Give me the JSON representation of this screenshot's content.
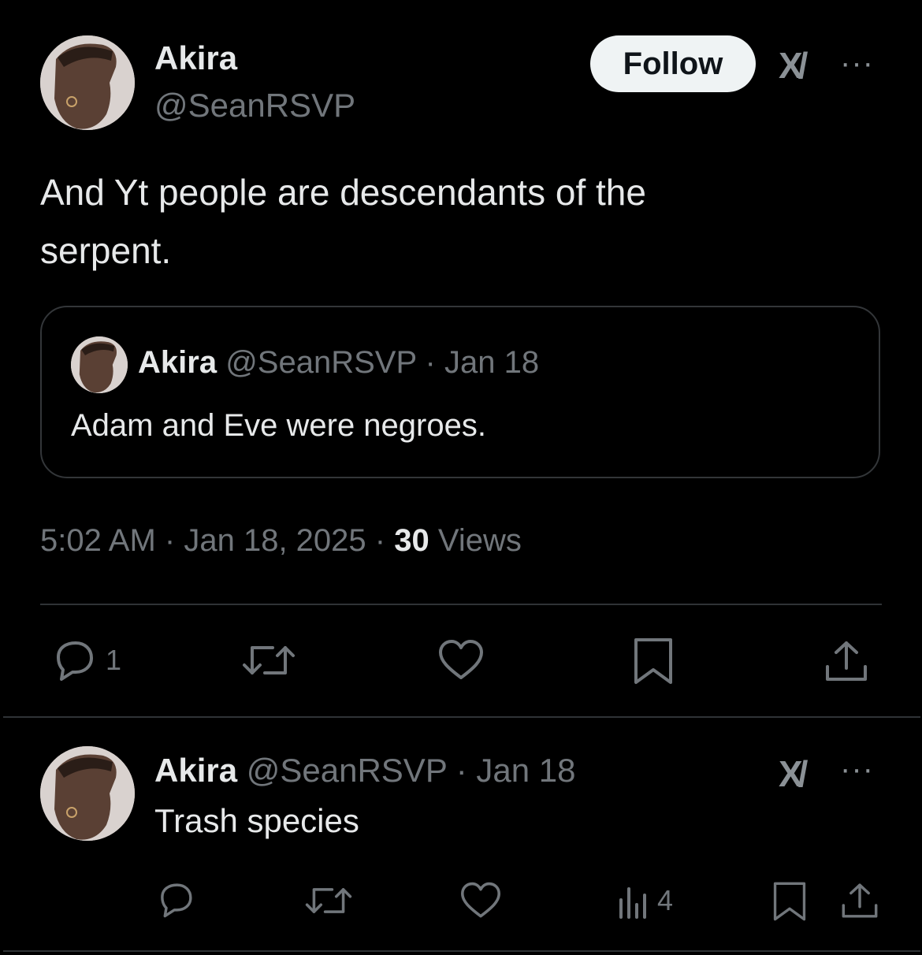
{
  "main_tweet": {
    "author": {
      "name": "Akira",
      "handle": "@SeanRSVP"
    },
    "follow_label": "Follow",
    "grok_label": "X/",
    "more_label": "···",
    "text": "And Yt people are descendants of the serpent.",
    "quote": {
      "name": "Akira",
      "handle": "@SeanRSVP",
      "sep": "·",
      "date": "Jan 18",
      "text": "Adam and Eve were negroes."
    },
    "meta": {
      "time": "5:02 AM",
      "sep1": "·",
      "date": "Jan 18, 2025",
      "sep2": "·",
      "views_count": "30",
      "views_label": "Views"
    },
    "actions": {
      "replies": "1",
      "reposts": "",
      "likes": "",
      "bookmarks": ""
    }
  },
  "reply": {
    "author": {
      "name": "Akira",
      "handle": "@SeanRSVP"
    },
    "sep": "·",
    "date": "Jan 18",
    "grok_label": "X/",
    "more_label": "···",
    "text": "Trash species",
    "actions": {
      "replies": "",
      "reposts": "",
      "likes": "",
      "views": "4"
    }
  },
  "icons": [
    "avatar",
    "grok-icon",
    "more-icon",
    "reply-icon",
    "repost-icon",
    "like-icon",
    "views-icon",
    "bookmark-icon",
    "share-icon"
  ]
}
